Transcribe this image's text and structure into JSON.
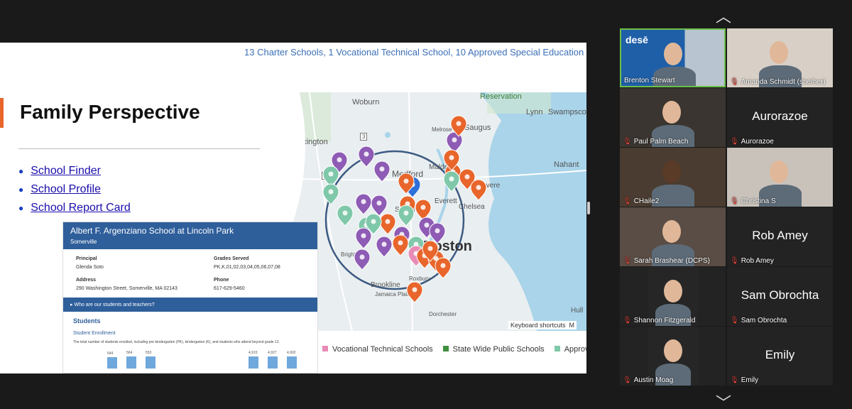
{
  "slide": {
    "top_line": "13 Charter Schools, 1 Vocational Technical School, 10 Approved Special Education",
    "title": "Family Perspective",
    "links": [
      "School Finder",
      "School Profile",
      "School Report Card"
    ]
  },
  "map": {
    "labels": [
      "Reservation",
      "Woburn",
      "Lynn",
      "Swampscott",
      "Lexington",
      "Saugus",
      "Melrose",
      "Malden",
      "Nahant",
      "Medford",
      "Everett",
      "Revere",
      "Somerville",
      "Chelsea",
      "Brighton",
      "Boston",
      "Brookline",
      "Roxbury",
      "Jamaica Plain",
      "Dorchester",
      "Hull"
    ],
    "keyboard_shortcuts": "Keyboard shortcuts",
    "map_suffix": "M",
    "road_marker": "95",
    "route_marker_2": "2",
    "route_marker_3": "3"
  },
  "card": {
    "school_name": "Albert F. Argenziano School at Lincoln Park",
    "town": "Somerville",
    "principal_label": "Principal",
    "principal": "Glenda Soto",
    "grades_label": "Grades Served",
    "grades": "PK,K,01,02,03,04,05,06,07,08",
    "address_label": "Address",
    "address": "290 Washington Street, Somerville, MA 02143",
    "phone_label": "Phone",
    "phone": "617-629-5460",
    "expander": "Who are our students and teachers?",
    "students_heading": "Students",
    "enrollment_heading": "Student Enrollment",
    "enrollment_desc": "The total number of students enrolled, including pre-kindergarten (PK), kindergarten (K), and students who attend beyond grade 12.",
    "bar_values_left": [
      544,
      564,
      553
    ],
    "bar_values_right": [
      4915,
      4927,
      4902
    ],
    "bar_labels_left": [
      "544",
      "564",
      "553"
    ],
    "bar_labels_right": [
      "4,915",
      "4,927",
      "4,902"
    ]
  },
  "legend": [
    {
      "label": "Vocational Technical Schools",
      "color": "#e88bb6"
    },
    {
      "label": "State Wide Public Schools",
      "color": "#3f8f3f"
    },
    {
      "label": "Approved",
      "color": "#7fc8a9"
    }
  ],
  "participants": [
    {
      "name": "Brenton Stewart",
      "muted": false,
      "video": true,
      "active": true,
      "logo": "desē"
    },
    {
      "name": "Amanda Schmidt (she/her)",
      "muted": true,
      "video": true
    },
    {
      "name": "Paul Palm Beach",
      "muted": true,
      "video": true
    },
    {
      "name": "Aurorazoe",
      "muted": true,
      "video": false
    },
    {
      "name": "CHaile2",
      "muted": true,
      "video": true
    },
    {
      "name": "Christina S",
      "muted": true,
      "video": true
    },
    {
      "name": "Sarah Brashear (DCPS)",
      "muted": true,
      "video": true
    },
    {
      "name": "Rob Amey",
      "muted": true,
      "video": false
    },
    {
      "name": "Shannon Fitzgerald",
      "muted": true,
      "video": true
    },
    {
      "name": "Sam Obrochta",
      "muted": true,
      "video": false
    },
    {
      "name": "Austin Moag",
      "muted": true,
      "video": true
    },
    {
      "name": "Emily",
      "muted": true,
      "video": false
    }
  ],
  "colors": {
    "purple_pin": "#8e5bb5",
    "orange_pin": "#e8652b",
    "teal_pin": "#7fc8a9",
    "blue_pin": "#2e6fd8",
    "pink_pin": "#e88bb6"
  }
}
